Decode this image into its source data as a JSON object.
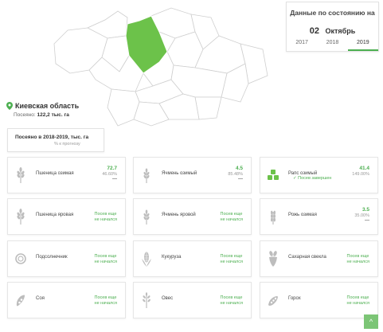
{
  "header": {
    "date_title": "Данные по состоянию на",
    "day": "02",
    "month": "Октябрь",
    "years": [
      "2017",
      "2018",
      "2019"
    ],
    "active_year": "2019"
  },
  "region": {
    "name": "Киевская область",
    "sown_label": "Посеяно:",
    "sown_value": "122,2 тыс. га"
  },
  "summary": {
    "title": "Посеяно в 2018-2019, тыс. га",
    "subtitle": "% к прогнозу"
  },
  "colors": {
    "accent": "#4caf50",
    "map_fill": "#6cc24a",
    "border": "#e2e2e2"
  },
  "crops": [
    {
      "name": "Пшеница озимая",
      "icon": "wheat-icon",
      "value": "72.7",
      "percent": "46.60%",
      "dash": "—"
    },
    {
      "name": "Ячмень озимый",
      "icon": "barley-icon",
      "value": "4.5",
      "percent": "85.48%",
      "dash": "—"
    },
    {
      "name": "Рапс озимый",
      "icon": "rapeseed-icon",
      "value": "41.4",
      "percent": "149.00%",
      "done": "✓ Посев завершен"
    },
    {
      "name": "Пшеница яровая",
      "icon": "wheat-icon",
      "status_line1": "Посев еще",
      "status_line2": "не начался"
    },
    {
      "name": "Ячмень яровой",
      "icon": "barley-icon",
      "status_line1": "Посев еще",
      "status_line2": "не начался"
    },
    {
      "name": "Рожь озимая",
      "icon": "rye-icon",
      "value": "3.5",
      "percent": "35.00%",
      "dash": "—"
    },
    {
      "name": "Подсолнечник",
      "icon": "sunflower-icon",
      "status_line1": "Посев еще",
      "status_line2": "не начался"
    },
    {
      "name": "Кукуруза",
      "icon": "corn-icon",
      "status_line1": "Посев еще",
      "status_line2": "не начался"
    },
    {
      "name": "Сахарная свекла",
      "icon": "beet-icon",
      "status_line1": "Посев еще",
      "status_line2": "не начался"
    },
    {
      "name": "Соя",
      "icon": "soy-icon",
      "status_line1": "Посев еще",
      "status_line2": "не начался"
    },
    {
      "name": "Овес",
      "icon": "oat-icon",
      "status_line1": "Посев еще",
      "status_line2": "не начался"
    },
    {
      "name": "Горох",
      "icon": "pea-icon",
      "status_line1": "Посев еще",
      "status_line2": "не начался"
    }
  ],
  "scroll_top": {
    "label": "^"
  }
}
